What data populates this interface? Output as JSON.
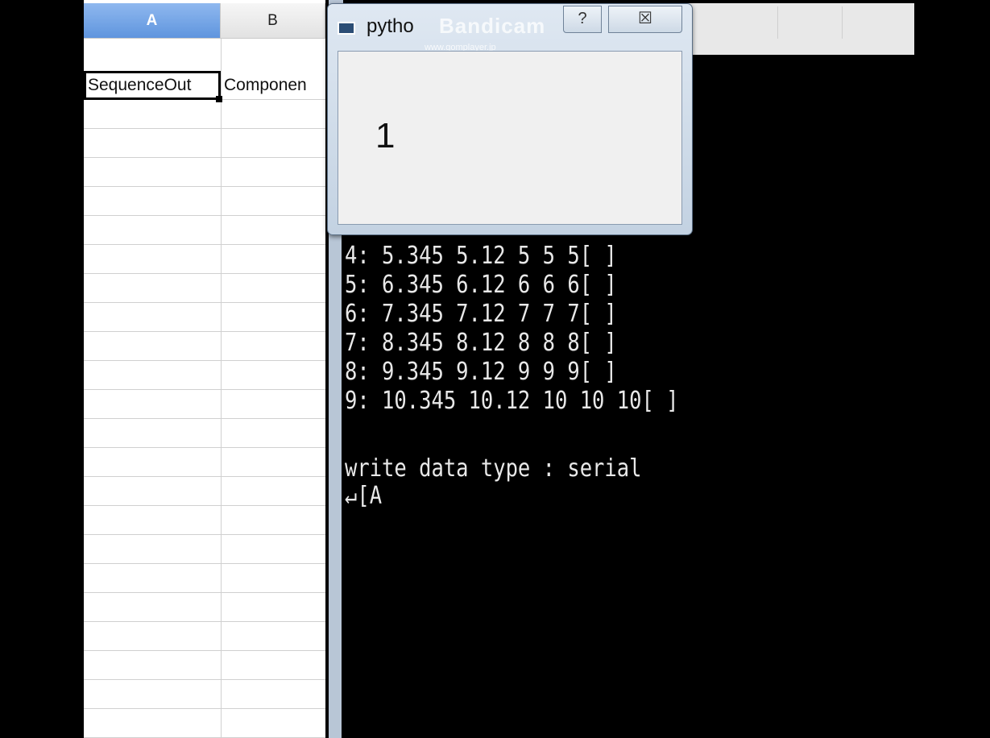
{
  "spreadsheet": {
    "columns": [
      "A",
      "B"
    ],
    "cells": {
      "A1": "SequenceOut",
      "B1": "Componen"
    }
  },
  "dialog": {
    "title": "pytho",
    "watermark": "Bandicam",
    "watermark_sub": "www.gomplayer.jp",
    "help_label": "?",
    "close_label": "☒",
    "value": "1"
  },
  "console": {
    "lines": [
      "4: 5.345 5.12 5 5 5[ ]",
      "5: 6.345 6.12 6 6 6[ ]",
      "6: 7.345 7.12 7 7 7[ ]",
      "7: 8.345 8.12 8 8 8[ ]",
      "8: 9.345 9.12 9 9 9[ ]",
      "9: 10.345 10.12 10 10 10[ ]",
      "",
      "write data type : serial",
      "↵[A"
    ]
  }
}
